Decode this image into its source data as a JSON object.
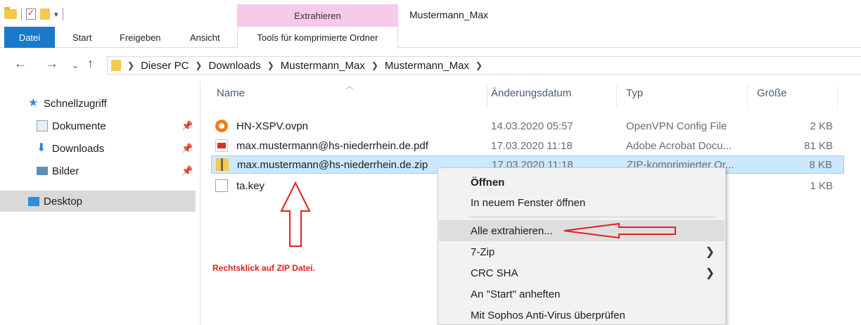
{
  "window": {
    "title": "Mustermann_Max",
    "context_tab_group": "Extrahieren"
  },
  "ribbon": {
    "tabs": [
      "Datei",
      "Start",
      "Freigeben",
      "Ansicht",
      "Tools für komprimierte Ordner"
    ]
  },
  "address": {
    "crumbs": [
      "Dieser PC",
      "Downloads",
      "Mustermann_Max",
      "Mustermann_Max"
    ]
  },
  "sidebar": {
    "items": [
      {
        "label": "Schnellzugriff",
        "icon": "star-icon",
        "pinned": false
      },
      {
        "label": "Dokumente",
        "icon": "documents-icon",
        "pinned": true
      },
      {
        "label": "Downloads",
        "icon": "download-icon",
        "pinned": true
      },
      {
        "label": "Bilder",
        "icon": "pictures-icon",
        "pinned": true
      },
      {
        "label": "Desktop",
        "icon": "desktop-icon",
        "pinned": false,
        "selected": true
      }
    ]
  },
  "columns": [
    "Name",
    "Änderungsdatum",
    "Typ",
    "Größe"
  ],
  "files": [
    {
      "name": "HN-XSPV.ovpn",
      "date": "14.03.2020 05:57",
      "type": "OpenVPN Config File",
      "size": "2 KB",
      "icon": "openvpn-icon"
    },
    {
      "name": "max.mustermann@hs-niederrhein.de.pdf",
      "date": "17.03.2020 11:18",
      "type": "Adobe Acrobat Docu...",
      "size": "81 KB",
      "icon": "pdf-icon"
    },
    {
      "name": "max.mustermann@hs-niederrhein.de.zip",
      "date": "17.03.2020 11:18",
      "type": "ZIP-komprimierter Or...",
      "size": "8 KB",
      "icon": "zip-folder-icon",
      "selected": true
    },
    {
      "name": "ta.key",
      "date": "",
      "type": "",
      "size": "1 KB",
      "icon": "file-icon"
    }
  ],
  "context_menu": {
    "items": [
      {
        "label": "Öffnen",
        "bold": true
      },
      {
        "label": "In neuem Fenster öffnen"
      },
      {
        "label": "Alle extrahieren...",
        "highlighted": true
      },
      {
        "label": "7-Zip",
        "submenu": true
      },
      {
        "label": "CRC SHA",
        "submenu": true
      },
      {
        "label": "An \"Start\" anheften"
      },
      {
        "label": "Mit Sophos Anti-Virus überprüfen"
      }
    ]
  },
  "annotation": {
    "text": "Rechtsklick auf ZIP Datei.",
    "color": "#e02020"
  },
  "colors": {
    "file_tab": "#1979ca",
    "context_tab": "#f7c9ea",
    "selection": "#cce8ff"
  }
}
